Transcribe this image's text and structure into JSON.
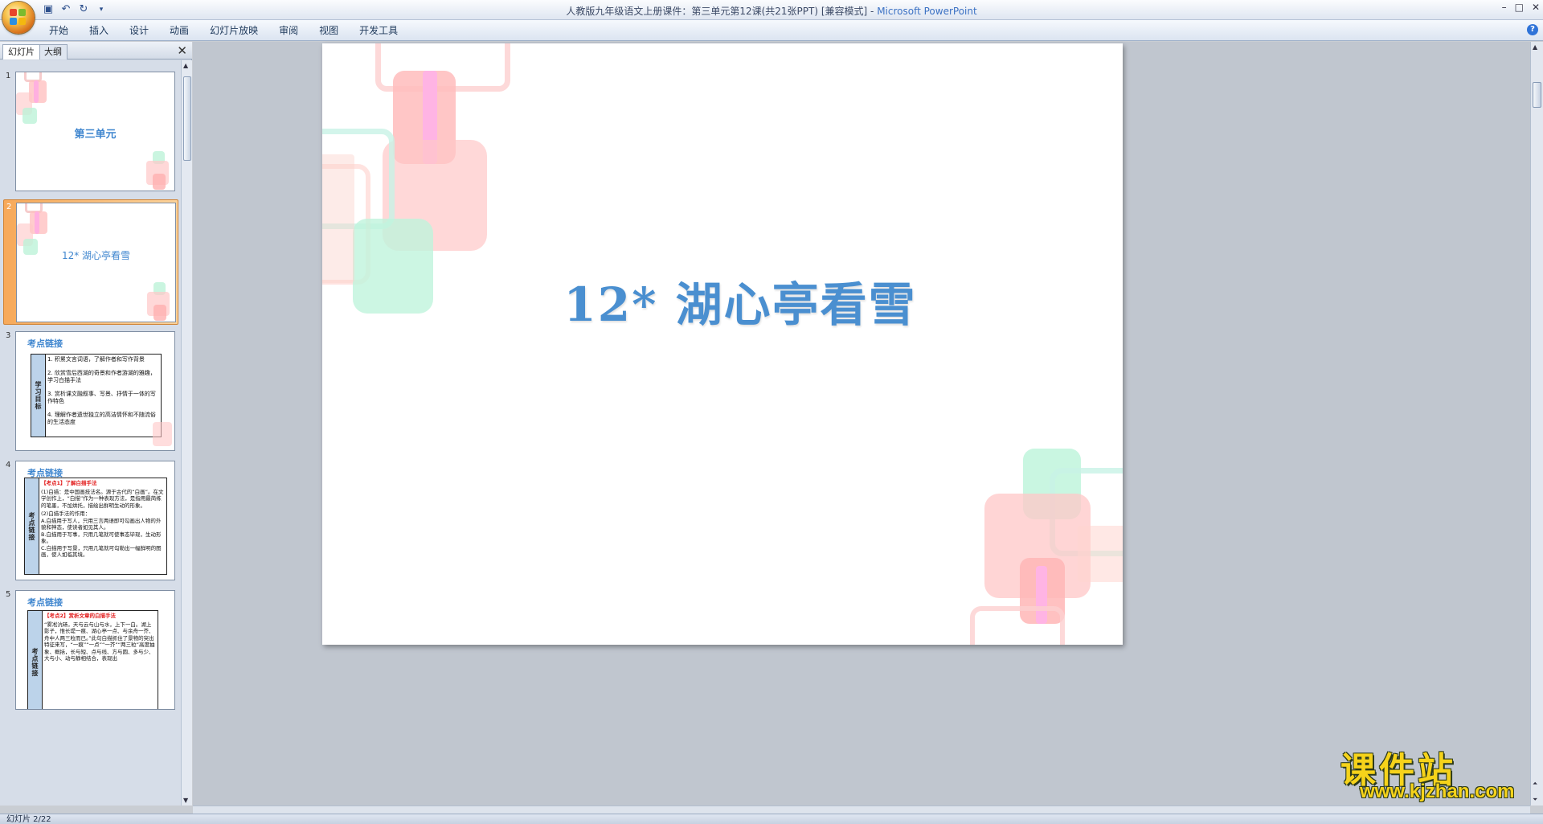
{
  "window": {
    "title": "人教版九年级语文上册课件：第三单元第12课(共21张PPT) [兼容模式]",
    "app_name": "Microsoft PowerPoint",
    "minimize": "–",
    "restore": "□",
    "close": "✕"
  },
  "qat": {
    "save": "save-icon",
    "undo": "undo-icon",
    "redo": "redo-icon",
    "customize": "▾"
  },
  "menu": {
    "tabs": [
      "开始",
      "插入",
      "设计",
      "动画",
      "幻灯片放映",
      "审阅",
      "视图",
      "开发工具"
    ],
    "help": "?"
  },
  "panel": {
    "tab_slides": "幻灯片",
    "tab_outline": "大纲",
    "close": "✕"
  },
  "thumbnails": [
    {
      "num": "1",
      "title": "第三单元"
    },
    {
      "num": "2",
      "title": "12*  湖心亭看雪"
    },
    {
      "num": "3",
      "heading": "考点链接",
      "side": "学习目标",
      "lines": [
        "1. 积累文言词语，了解作者和写作背景",
        "2. 欣赏雪后西湖的奇景和作者游湖的雅趣，学习白描手法",
        "3. 赏析课文融叙事、写景、抒情于一体的写作特色",
        "4. 理解作者遗世独立的高洁情怀和不随流俗的生活态度"
      ]
    },
    {
      "num": "4",
      "heading": "考点链接",
      "side": "考点链接",
      "highlight": "【考点1】了解白描手法",
      "lines": [
        "(1)白描：是中国画技法名。源于古代的“白画”。在文学创作上，“白描”作为一种表现方法，是指用最简练的笔墨，不加烘托，描绘出鲜明生动的形象。",
        "(2)白描手法的作用：",
        "A.白描用于写人，只用三言两语即可勾画出人物的外貌和神态，使读者如见其人。",
        "B.白描用于写事，只用几笔就可使事态毕现，生动形象。",
        "C.白描用于写景，只用几笔就可勾勒出一幅鲜明的图画，使人如临其境。"
      ]
    },
    {
      "num": "5",
      "heading": "考点链接",
      "side": "考点链接",
      "highlight": "【考点2】赏析文章的白描手法",
      "lines": [
        "“雾凇沆砀，天与云与山与水，上下一白。湖上影子，惟长堤一痕、湖心亭一点、与余舟一芥、舟中人两三粒而已。”此句白描抓住了景物的突出特征来写，“一痕”“一点”“一芥”“两三粒”高度抽象、概括，长与短、点与线、方与圆、多与少、大与小、动与静相结合，表现出"
      ]
    }
  ],
  "slide": {
    "title": "12*   湖心亭看雪"
  },
  "status": {
    "slide_counter": "幻灯片 2/22"
  },
  "watermark": {
    "text": "课件站",
    "url": "www.kjzhan.com"
  },
  "colors": {
    "accent": "#4a8fd0",
    "selection": "#f7a95a",
    "watermark": "#f6d31a"
  }
}
